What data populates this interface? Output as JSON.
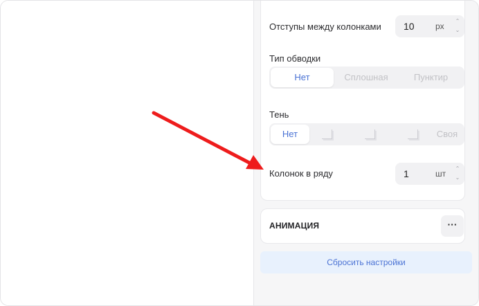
{
  "layout_panel": {
    "column_gap": {
      "label": "Отступы между колонками",
      "value": "10",
      "unit": "px"
    },
    "border_type": {
      "label": "Тип обводки",
      "options": [
        "Нет",
        "Сплошная",
        "Пунктир"
      ],
      "selected": "Нет"
    },
    "shadow": {
      "label": "Тень",
      "options": [
        "Нет",
        "shadow-small",
        "shadow-medium",
        "shadow-large",
        "Своя"
      ],
      "option_labels": {
        "none": "Нет",
        "custom": "Своя"
      },
      "selected": "Нет"
    },
    "columns_per_row": {
      "label": "Колонок в ряду",
      "value": "1",
      "unit": "шт"
    }
  },
  "animation": {
    "title": "АНИМАЦИЯ",
    "more_label": "···"
  },
  "reset_label": "Сбросить настройки",
  "colors": {
    "accent": "#4a72d4",
    "reset_bg": "#e8f1fd",
    "annotation_arrow": "#ee1c1c"
  },
  "icons": {
    "stepper_up": "chevron-up-icon",
    "stepper_down": "chevron-down-icon",
    "shadow_options": "shadow-corner-icon",
    "annotation": "red-arrow-icon"
  }
}
